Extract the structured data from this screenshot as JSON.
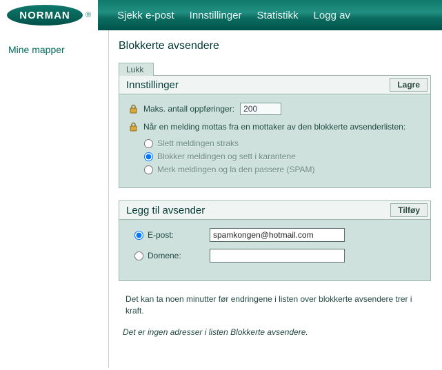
{
  "brand": {
    "name": "NORMAN",
    "registered": "®"
  },
  "nav": {
    "check_mail": "Sjekk e-post",
    "settings": "Innstillinger",
    "statistics": "Statistikk",
    "logout": "Logg av"
  },
  "sidebar": {
    "my_folders": "Mine mapper"
  },
  "page": {
    "title": "Blokkerte avsendere"
  },
  "close_tab": "Lukk",
  "settings_panel": {
    "title": "Innstillinger",
    "save_label": "Lagre",
    "max_entries_label": "Maks. antall oppføringer:",
    "max_entries_value": "200",
    "on_receive_label": "Når en melding mottas fra en mottaker av den blokkerte avsenderlisten:",
    "options": {
      "delete": "Slett meldingen straks",
      "quarantine": "Blokker meldingen og sett i karantene",
      "mark_pass": "Merk meldingen og la den passere (SPAM)"
    },
    "selected": "quarantine"
  },
  "add_panel": {
    "title": "Legg til avsender",
    "add_label": "Tilføy",
    "email_label": "E-post:",
    "domain_label": "Domene:",
    "email_value": "spamkongen@hotmail.com",
    "domain_value": "",
    "selected": "email"
  },
  "footer": {
    "note": "Det kan ta noen minutter før endringene i listen over blokkerte avsendere trer i kraft.",
    "empty": "Det er ingen adresser i listen Blokkerte avsendere."
  }
}
